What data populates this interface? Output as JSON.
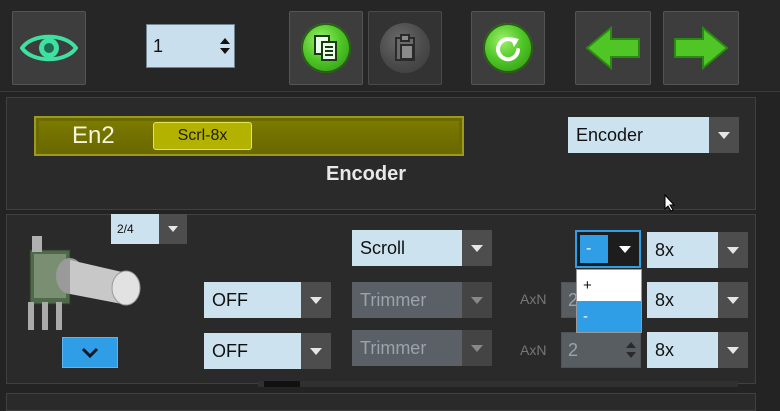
{
  "toolbar": {
    "layer_value": "1",
    "buttons": [
      "eye-icon",
      "copy-icon",
      "paste-icon",
      "refresh-icon",
      "arrow-left-icon",
      "arrow-right-icon"
    ]
  },
  "control": {
    "lcd_name": "En2",
    "lcd_tag": "Scrl-8x",
    "type_select": "Encoder",
    "type_heading": "Encoder"
  },
  "settings": {
    "page_select": "2/4",
    "mode_select": "Scroll",
    "rows": [
      {
        "toggle": "OFF",
        "function": "Trimmer",
        "axn_label": "AxN",
        "axn_value": "2",
        "mult": "8x"
      },
      {
        "toggle": "OFF",
        "function": "Trimmer",
        "axn_label": "AxN",
        "axn_value": "2",
        "mult": "8x"
      }
    ],
    "top_mult": "8x",
    "sign_select": "-",
    "sign_options": [
      "+",
      "-"
    ]
  },
  "colors": {
    "accent": "#2f9ee6",
    "lcd": "#6b6a00",
    "green": "#4fc626"
  }
}
